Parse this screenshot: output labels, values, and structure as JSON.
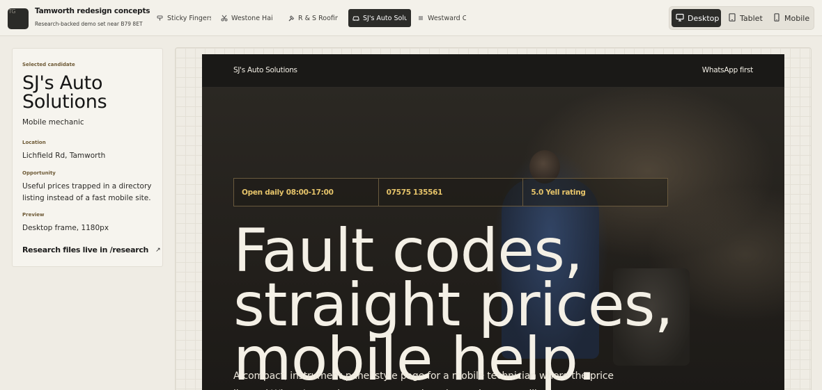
{
  "app": {
    "logo_text": "TG",
    "title": "Tamworth redesign concepts",
    "subtitle": "Research-backed demo set near B79 8ET"
  },
  "tabs": [
    {
      "label": "Sticky Fingers",
      "icon": "paint-roller-icon",
      "active": false
    },
    {
      "label": "Westone Hair",
      "icon": "scissors-icon",
      "active": false
    },
    {
      "label": "R & S Roofing",
      "icon": "hammer-icon",
      "active": false
    },
    {
      "label": "SJ's Auto Solutions",
      "icon": "car-icon",
      "active": true
    },
    {
      "label": "Westward Cleaning",
      "icon": "menu-lines-icon",
      "active": false
    }
  ],
  "devices": [
    {
      "label": "Desktop",
      "icon": "monitor-icon",
      "active": true
    },
    {
      "label": "Tablet",
      "icon": "tablet-icon",
      "active": false
    },
    {
      "label": "Mobile",
      "icon": "phone-icon",
      "active": false
    }
  ],
  "candidate": {
    "kicker": "Selected candidate",
    "name": "SJ's Auto Solutions",
    "category": "Mobile mechanic",
    "location_label": "Location",
    "location": "Lichfield Rd, Tamworth",
    "opportunity_label": "Opportunity",
    "opportunity": "Useful prices trapped in a directory listing instead of a fast mobile site.",
    "preview_label": "Preview",
    "preview": "Desktop frame, 1180px",
    "research_link": "Research files live in /research",
    "research_arrow": "↗"
  },
  "site": {
    "brand": "SJ's Auto Solutions",
    "cta": "WhatsApp first",
    "strip": [
      "Open daily 08:00-17:00",
      "07575 135561",
      "5.0 Yell rating"
    ],
    "headline": "Fault codes, straight prices, mobile help.",
    "lede": "A compact, instrument-panel style page for a mobile technician where the price list and WhatsApp action matter more than decorative storytelling."
  },
  "colors": {
    "accent": "#e6c46a",
    "dark": "#2c2c29",
    "page_bg": "#efece4"
  }
}
